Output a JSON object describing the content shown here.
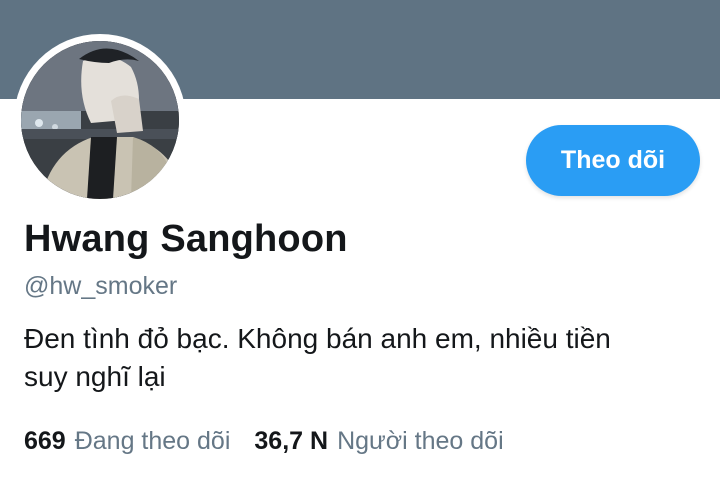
{
  "profile": {
    "name": "Hwang Sanghoon",
    "handle": "@hw_smoker",
    "bio_line1": "Đen tình đỏ bạc. Không bán anh em, nhiều tiền",
    "bio_line2": "suy nghĩ lại",
    "follow_label": "Theo dõi"
  },
  "stats": {
    "following_count": "669",
    "following_label": "Đang theo dõi",
    "followers_count": "36,7 N",
    "followers_label": "Người theo dõi"
  },
  "colors": {
    "banner": "#5f7383",
    "accent": "#2a9df4",
    "secondary_text": "#657786",
    "primary_text": "#14171a"
  }
}
